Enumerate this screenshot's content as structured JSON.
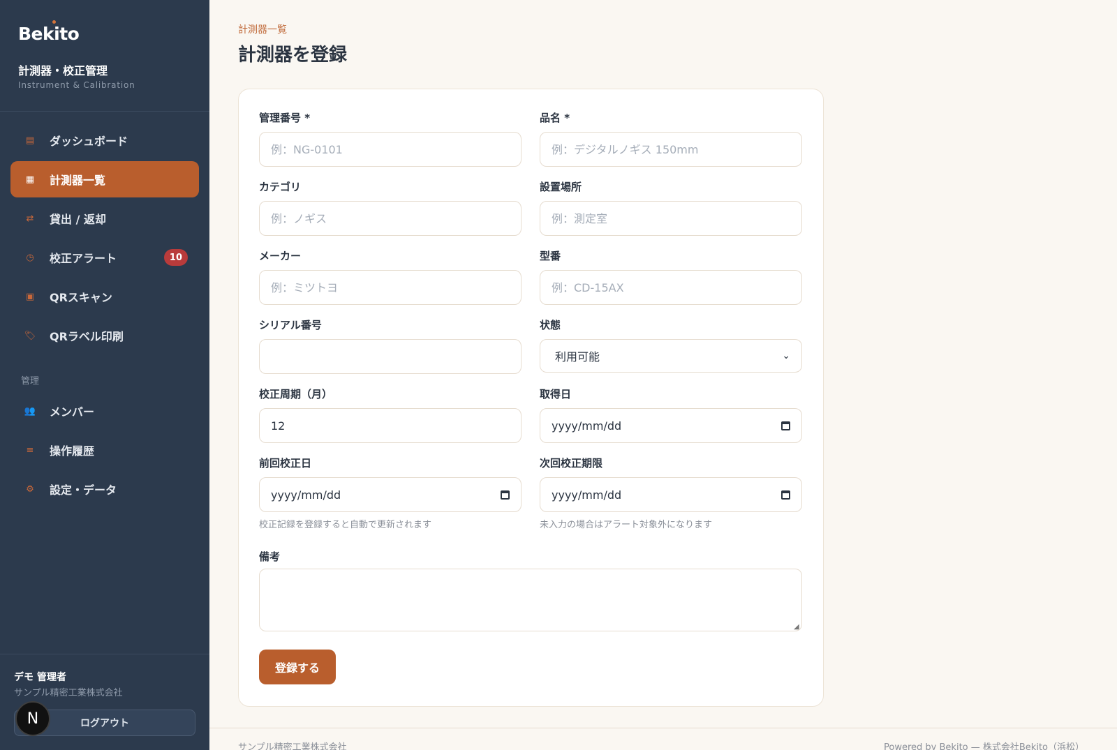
{
  "sidebar": {
    "logo": "Bekito",
    "app_title": "計測器・校正管理",
    "app_subtitle": "Instrument & Calibration",
    "items": [
      {
        "label": "ダッシュボード",
        "icon": "dashboard-icon",
        "glyph": "▤"
      },
      {
        "label": "計測器一覧",
        "icon": "grid-icon",
        "glyph": "▦",
        "active": true
      },
      {
        "label": "貸出 / 返却",
        "icon": "swap-arrows-icon",
        "glyph": "⇄"
      },
      {
        "label": "校正アラート",
        "icon": "clock-icon",
        "glyph": "◷",
        "badge": "10"
      },
      {
        "label": "QRスキャン",
        "icon": "qr-scan-icon",
        "glyph": "▣"
      },
      {
        "label": "QRラベル印刷",
        "icon": "label-tag-icon",
        "glyph": "🏷"
      }
    ],
    "admin_section_label": "管理",
    "admin_items": [
      {
        "label": "メンバー",
        "icon": "members-icon",
        "glyph": "👥"
      },
      {
        "label": "操作履歴",
        "icon": "list-icon",
        "glyph": "≡"
      },
      {
        "label": "設定・データ",
        "icon": "gear-icon",
        "glyph": "⚙"
      }
    ],
    "user_name": "デモ 管理者",
    "user_org": "サンプル精密工業株式会社",
    "logout_label": "ログアウト",
    "avatar_letter": "N"
  },
  "main": {
    "breadcrumb": "計測器一覧",
    "title": "計測器を登録",
    "form": {
      "control_no": {
        "label": "管理番号 *",
        "placeholder": "例：NG-0101"
      },
      "product_name": {
        "label": "品名 *",
        "placeholder": "例：デジタルノギス 150mm"
      },
      "category": {
        "label": "カテゴリ",
        "placeholder": "例：ノギス"
      },
      "location": {
        "label": "設置場所",
        "placeholder": "例：測定室"
      },
      "maker": {
        "label": "メーカー",
        "placeholder": "例：ミツトヨ"
      },
      "model": {
        "label": "型番",
        "placeholder": "例：CD-15AX"
      },
      "serial": {
        "label": "シリアル番号",
        "value": ""
      },
      "status": {
        "label": "状態",
        "value": "利用可能"
      },
      "calib_cycle": {
        "label": "校正周期（月）",
        "value": "12"
      },
      "acquired_date": {
        "label": "取得日",
        "value": "yyyy/mm/dd"
      },
      "last_calib": {
        "label": "前回校正日",
        "value": "yyyy/mm/dd",
        "hint": "校正記録を登録すると自動で更新されます"
      },
      "next_calib": {
        "label": "次回校正期限",
        "value": "yyyy/mm/dd",
        "hint": "未入力の場合はアラート対象外になります"
      },
      "notes": {
        "label": "備考"
      },
      "submit_label": "登録する"
    }
  },
  "footer": {
    "left": "サンプル精密工業株式会社",
    "right": "Powered by Bekito — 株式会社Bekito（浜松）"
  },
  "colors": {
    "sidebar_bg": "#2c3a4d",
    "accent": "#b95e2d",
    "badge": "#b93b3b",
    "page_bg": "#faf7f2"
  }
}
